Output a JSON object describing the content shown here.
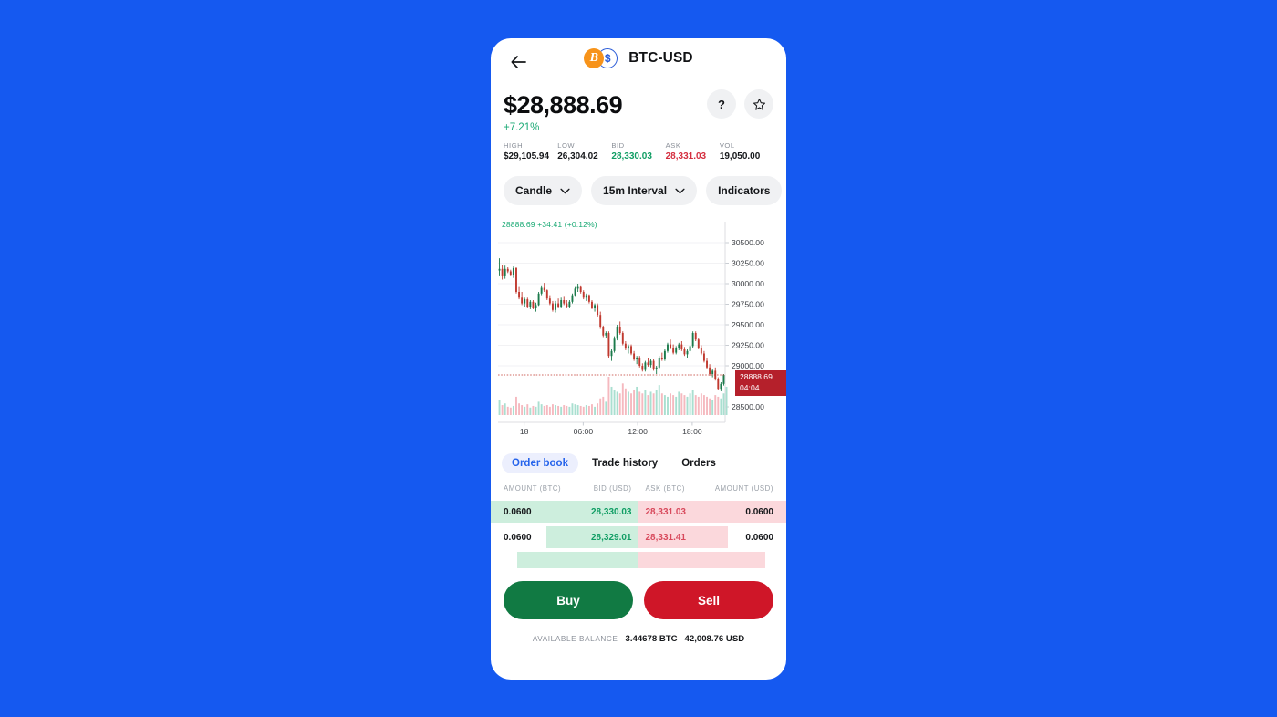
{
  "header": {
    "back_icon": "arrow-left-icon",
    "logo_btc_symbol": "B",
    "logo_usd_symbol": "$",
    "pair": "BTC-USD"
  },
  "price": {
    "value": "$28,888.69",
    "change_pct": "+7.21%",
    "help_label": "?",
    "star_icon": "star-icon"
  },
  "stats": [
    {
      "label": "HIGH",
      "value": "$29,105.94",
      "tone": ""
    },
    {
      "label": "LOW",
      "value": "26,304.02",
      "tone": ""
    },
    {
      "label": "BID",
      "value": "28,330.03",
      "tone": "green"
    },
    {
      "label": "ASK",
      "value": "28,331.03",
      "tone": "red"
    },
    {
      "label": "VOL",
      "value": "19,050.00",
      "tone": ""
    }
  ],
  "controls": [
    {
      "label": "Candle",
      "icon": "chevron-down-icon"
    },
    {
      "label": "15m Interval",
      "icon": "chevron-down-icon"
    },
    {
      "label": "Indicators",
      "icon": ""
    }
  ],
  "chart_legend": "28888.69  +34.41 (+0.12%)",
  "price_tag": {
    "price": "28888.69",
    "time": "04:04"
  },
  "orderbook": {
    "tabs": [
      {
        "label": "Order book",
        "active": true
      },
      {
        "label": "Trade history",
        "active": false
      },
      {
        "label": "Orders",
        "active": false
      }
    ],
    "columns": [
      "AMOUNT (BTC)",
      "BID (USD)",
      "ASK (BTC)",
      "AMOUNT (USD)"
    ],
    "rows": [
      {
        "amount_bid": "0.0600",
        "bid": "28,330.03",
        "ask": "28,331.03",
        "amount_ask": "0.0600",
        "bid_w": 64,
        "ask_w": 74
      },
      {
        "amount_bid": "0.0600",
        "bid": "28,329.01",
        "ask": "28,331.41",
        "amount_ask": "0.0600",
        "bid_w": 34,
        "ask_w": 33
      },
      {
        "amount_bid": "",
        "bid": "",
        "ask": "",
        "amount_ask": "",
        "bid_w": 45,
        "ask_w": 47
      }
    ]
  },
  "actions": {
    "buy": "Buy",
    "sell": "Sell"
  },
  "balance": {
    "label": "AVAILABLE BALANCE",
    "btc": "3.44678 BTC",
    "usd": "42,008.76 USD"
  },
  "colors": {
    "background": "#1559f0",
    "up": "#0f9d63",
    "down": "#d42d3e",
    "accent": "#2563eb",
    "buy": "#117a43",
    "sell": "#cf1628"
  },
  "chart_data": {
    "type": "candlestick",
    "title": "",
    "xlabel": "",
    "ylabel": "",
    "ylim": [
      28400,
      30600
    ],
    "yticks": [
      30500,
      30250,
      30000,
      29750,
      29500,
      29250,
      29000,
      28500
    ],
    "ytick_labels": [
      "30500.00",
      "30250.00",
      "30000.00",
      "29750.00",
      "29500.00",
      "29250.00",
      "29000.00",
      "28500.00"
    ],
    "xtick_labels": [
      "18",
      "06:00",
      "12:00",
      "18:00"
    ],
    "xtick_pos": [
      0.115,
      0.375,
      0.615,
      0.855
    ],
    "current_price": 28888.69,
    "current_label": "28888.69",
    "current_time": "04:04",
    "grid": true,
    "candles": [
      [
        30160,
        30310,
        30090,
        30180
      ],
      [
        30180,
        30230,
        30050,
        30090
      ],
      [
        30090,
        30220,
        30060,
        30180
      ],
      [
        30180,
        30200,
        30130,
        30150
      ],
      [
        30150,
        30170,
        30090,
        30100
      ],
      [
        30100,
        30210,
        30070,
        30190
      ],
      [
        30190,
        30200,
        29880,
        29900
      ],
      [
        29900,
        29960,
        29810,
        29830
      ],
      [
        29830,
        29900,
        29740,
        29760
      ],
      [
        29760,
        29830,
        29720,
        29810
      ],
      [
        29810,
        29830,
        29700,
        29720
      ],
      [
        29720,
        29800,
        29690,
        29780
      ],
      [
        29780,
        29800,
        29690,
        29700
      ],
      [
        29700,
        29770,
        29660,
        29740
      ],
      [
        29740,
        29900,
        29730,
        29880
      ],
      [
        29880,
        29980,
        29860,
        29950
      ],
      [
        29950,
        30010,
        29900,
        29920
      ],
      [
        29920,
        29930,
        29800,
        29820
      ],
      [
        29820,
        29860,
        29740,
        29760
      ],
      [
        29760,
        29790,
        29660,
        29680
      ],
      [
        29680,
        29790,
        29650,
        29760
      ],
      [
        29760,
        29820,
        29700,
        29720
      ],
      [
        29720,
        29830,
        29700,
        29800
      ],
      [
        29800,
        29840,
        29740,
        29760
      ],
      [
        29760,
        29800,
        29700,
        29720
      ],
      [
        29720,
        29800,
        29700,
        29780
      ],
      [
        29780,
        29880,
        29760,
        29860
      ],
      [
        29860,
        29960,
        29840,
        29940
      ],
      [
        29940,
        30000,
        29900,
        29960
      ],
      [
        29960,
        29980,
        29880,
        29900
      ],
      [
        29900,
        29920,
        29810,
        29830
      ],
      [
        29830,
        29880,
        29790,
        29860
      ],
      [
        29860,
        29870,
        29760,
        29780
      ],
      [
        29780,
        29800,
        29690,
        29700
      ],
      [
        29700,
        29760,
        29660,
        29740
      ],
      [
        29740,
        29760,
        29600,
        29620
      ],
      [
        29620,
        29660,
        29450,
        29470
      ],
      [
        29470,
        29490,
        29350,
        29370
      ],
      [
        29370,
        29420,
        29340,
        29400
      ],
      [
        29400,
        29420,
        29100,
        29120
      ],
      [
        29120,
        29200,
        29060,
        29180
      ],
      [
        29180,
        29360,
        29160,
        29330
      ],
      [
        29330,
        29500,
        29310,
        29470
      ],
      [
        29470,
        29540,
        29380,
        29400
      ],
      [
        29400,
        29420,
        29250,
        29270
      ],
      [
        29270,
        29300,
        29190,
        29210
      ],
      [
        29210,
        29260,
        29150,
        29240
      ],
      [
        29240,
        29260,
        29130,
        29150
      ],
      [
        29150,
        29180,
        29060,
        29080
      ],
      [
        29080,
        29120,
        29020,
        29100
      ],
      [
        29100,
        29120,
        28980,
        29000
      ],
      [
        29000,
        29030,
        28930,
        28950
      ],
      [
        28950,
        29060,
        28930,
        29040
      ],
      [
        29040,
        29100,
        28990,
        29010
      ],
      [
        29010,
        29080,
        28980,
        29060
      ],
      [
        29060,
        29080,
        28940,
        28960
      ],
      [
        28960,
        29000,
        28900,
        28980
      ],
      [
        28980,
        29120,
        28960,
        29100
      ],
      [
        29100,
        29160,
        29060,
        29080
      ],
      [
        29080,
        29200,
        29060,
        29180
      ],
      [
        29180,
        29280,
        29160,
        29260
      ],
      [
        29260,
        29320,
        29200,
        29220
      ],
      [
        29220,
        29260,
        29140,
        29160
      ],
      [
        29160,
        29240,
        29140,
        29220
      ],
      [
        29220,
        29280,
        29190,
        29260
      ],
      [
        29260,
        29300,
        29180,
        29200
      ],
      [
        29200,
        29230,
        29120,
        29140
      ],
      [
        29140,
        29200,
        29100,
        29180
      ],
      [
        29180,
        29260,
        29160,
        29240
      ],
      [
        29240,
        29420,
        29220,
        29400
      ],
      [
        29400,
        29420,
        29300,
        29320
      ],
      [
        29320,
        29340,
        29200,
        29220
      ],
      [
        29220,
        29250,
        29130,
        29150
      ],
      [
        29150,
        29180,
        29040,
        29060
      ],
      [
        29060,
        29100,
        28960,
        28980
      ],
      [
        28980,
        29020,
        28880,
        28900
      ],
      [
        28900,
        28960,
        28860,
        28940
      ],
      [
        28940,
        28980,
        28820,
        28840
      ],
      [
        28840,
        28860,
        28700,
        28720
      ],
      [
        28720,
        28800,
        28690,
        28780
      ],
      [
        28780,
        28900,
        28760,
        28889
      ]
    ],
    "volumes": [
      18,
      12,
      14,
      10,
      9,
      11,
      22,
      14,
      12,
      10,
      13,
      9,
      11,
      10,
      16,
      13,
      11,
      12,
      10,
      13,
      12,
      11,
      10,
      12,
      11,
      10,
      14,
      13,
      12,
      11,
      10,
      12,
      11,
      13,
      10,
      14,
      20,
      22,
      16,
      46,
      34,
      30,
      28,
      26,
      38,
      32,
      28,
      26,
      30,
      34,
      28,
      26,
      30,
      24,
      28,
      26,
      30,
      36,
      26,
      24,
      22,
      26,
      24,
      22,
      28,
      26,
      24,
      22,
      26,
      30,
      24,
      22,
      26,
      24,
      22,
      20,
      18,
      24,
      22,
      20,
      26,
      34
    ]
  }
}
